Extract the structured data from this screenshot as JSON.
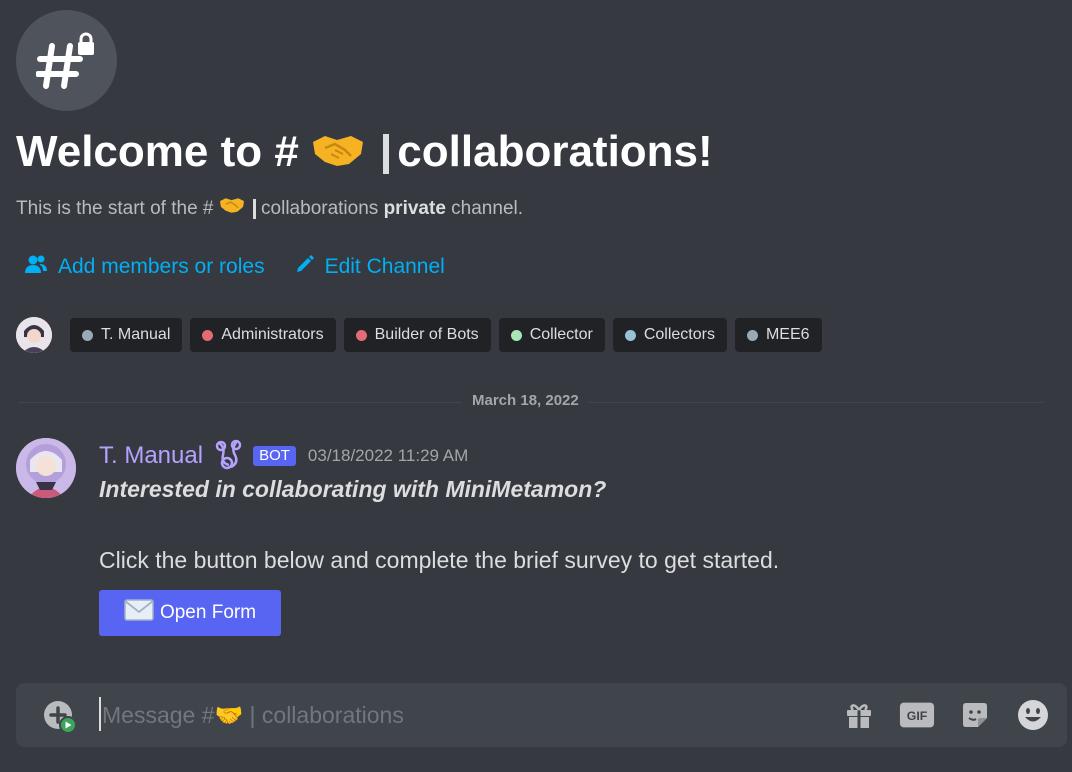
{
  "channel": {
    "welcome_prefix": "Welcome to #",
    "name": "collaborations",
    "welcome_suffix": "!",
    "subtitle_prefix": "This is the start of the #",
    "subtitle_channel": "collaborations",
    "subtitle_bold": "private",
    "subtitle_suffix": "channel."
  },
  "actions": {
    "add_members": "Add members or roles",
    "edit_channel": "Edit Channel"
  },
  "roles": [
    {
      "label": "T. Manual",
      "color": "#99aab5"
    },
    {
      "label": "Administrators",
      "color": "#e06c75"
    },
    {
      "label": "Builder of Bots",
      "color": "#e06c75"
    },
    {
      "label": "Collector",
      "color": "#a8e6b8"
    },
    {
      "label": "Collectors",
      "color": "#99c2d6"
    },
    {
      "label": "MEE6",
      "color": "#99aab5"
    }
  ],
  "divider": {
    "date": "March 18, 2022"
  },
  "message": {
    "author": "T. Manual",
    "bot_tag": "BOT",
    "timestamp": "03/18/2022 11:29 AM",
    "line_bold": "Interested in collaborating with MiniMetamon?",
    "line_body": "Click the button below and complete the brief survey to get started.",
    "button_label": "Open Form"
  },
  "composer": {
    "placeholder_prefix": "Message #",
    "placeholder_channel": "collaborations",
    "icons": [
      "gift-icon",
      "gif-icon",
      "sticker-icon",
      "emoji-icon"
    ]
  },
  "colors": {
    "background": "#36393f",
    "link": "#00aff4",
    "blurple": "#5865f2",
    "author": "#b5a2ff"
  }
}
